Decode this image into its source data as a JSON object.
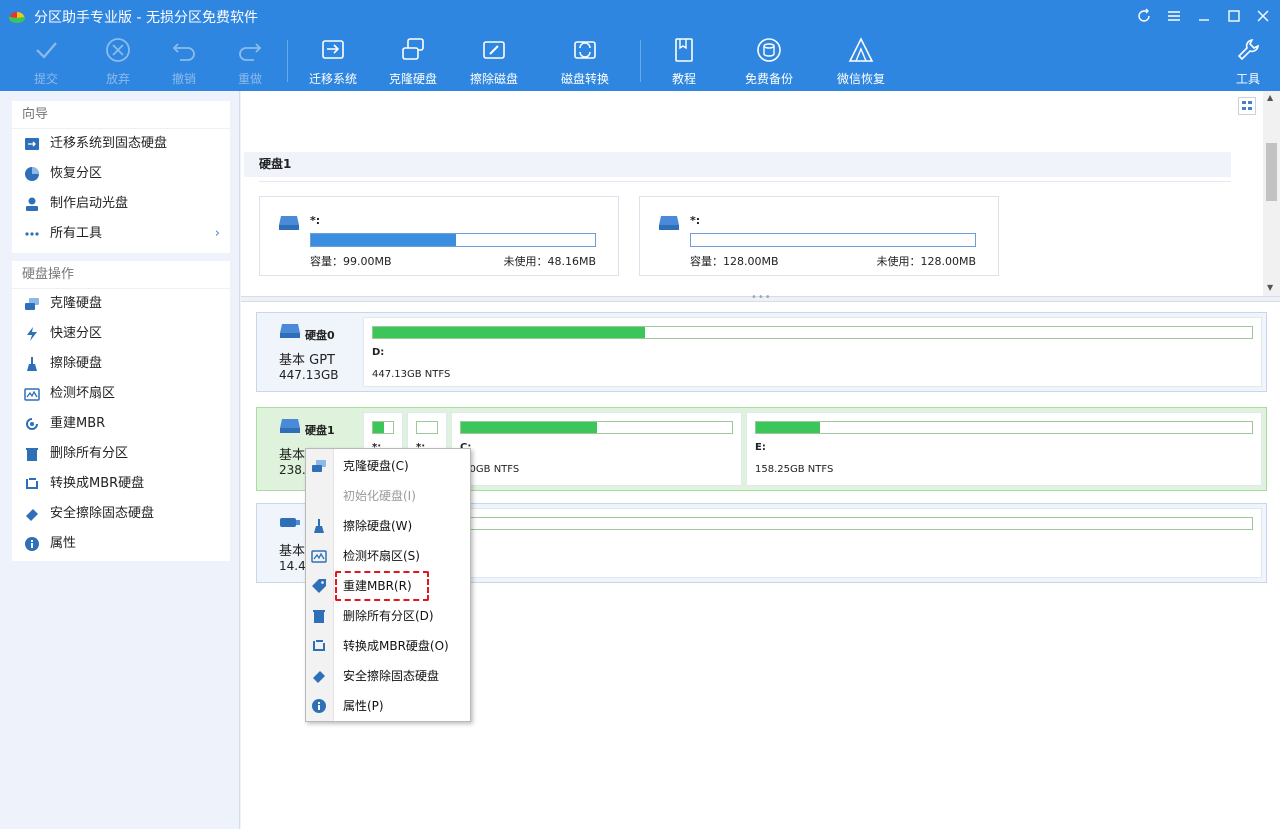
{
  "window": {
    "title": "分区助手专业版 - 无损分区免费软件",
    "controls": [
      "refresh-icon",
      "menu-icon",
      "minimize-icon",
      "maximize-icon",
      "close-icon"
    ]
  },
  "toolbar": {
    "submit": "提交",
    "discard": "放弃",
    "undo": "撤销",
    "redo": "重做",
    "migrate": "迁移系统",
    "clone": "克隆硬盘",
    "wipe": "擦除磁盘",
    "convert": "磁盘转换",
    "tutorial": "教程",
    "backup": "免费备份",
    "wechat": "微信恢复",
    "tools": "工具"
  },
  "sidebar": {
    "wizard": {
      "title": "向导",
      "items": [
        "迁移系统到固态硬盘",
        "恢复分区",
        "制作启动光盘",
        "所有工具"
      ]
    },
    "disk_ops": {
      "title": "硬盘操作",
      "items": [
        "克隆硬盘",
        "快速分区",
        "擦除硬盘",
        "检测坏扇区",
        "重建MBR",
        "删除所有分区",
        "转换成MBR硬盘",
        "安全擦除固态硬盘",
        "属性"
      ]
    }
  },
  "top_pane": {
    "disk_title": "硬盘1",
    "partitions": [
      {
        "name": "*:",
        "capacity": "容量：99.00MB",
        "unused": "未使用：48.16MB",
        "fill": 0.51
      },
      {
        "name": "*:",
        "capacity": "容量：128.00MB",
        "unused": "未使用：128.00MB",
        "fill": 0.0
      }
    ]
  },
  "disks": [
    {
      "name": "硬盘0",
      "type": "基本 GPT",
      "size": "447.13GB",
      "partitions": [
        {
          "label": "D:",
          "size": "447.13GB NTFS",
          "fill": 0.31
        }
      ]
    },
    {
      "name": "硬盘1",
      "type": "基本",
      "size": "238.4",
      "partitions": [
        {
          "label": "*:",
          "size": "",
          "fill": 0.55
        },
        {
          "label": "*:",
          "size": "",
          "fill": 0.0
        },
        {
          "label": "C:",
          "size": ".00GB NTFS",
          "fill": 0.5
        },
        {
          "label": "E:",
          "size": "158.25GB NTFS",
          "fill": 0.13
        }
      ]
    },
    {
      "name": "",
      "type": "基本",
      "size": "14.4",
      "partitions": [
        {
          "label": "",
          "size": "",
          "fill": 0.0
        }
      ]
    }
  ],
  "context_menu": {
    "items": [
      {
        "label": "克隆硬盘(C)",
        "icon": "clone-icon",
        "enabled": true
      },
      {
        "label": "初始化硬盘(I)",
        "icon": "init-icon",
        "enabled": false
      },
      {
        "label": "擦除硬盘(W)",
        "icon": "wipe-icon",
        "enabled": true
      },
      {
        "label": "检测坏扇区(S)",
        "icon": "scan-icon",
        "enabled": true
      },
      {
        "label": "重建MBR(R)",
        "icon": "tag-icon",
        "enabled": true
      },
      {
        "label": "删除所有分区(D)",
        "icon": "trash-icon",
        "enabled": true
      },
      {
        "label": "转换成MBR硬盘(O)",
        "icon": "convert-icon",
        "enabled": true
      },
      {
        "label": "安全擦除固态硬盘",
        "icon": "eraser-icon",
        "enabled": true
      },
      {
        "label": "属性(P)",
        "icon": "info-icon",
        "enabled": true
      }
    ]
  },
  "colors": {
    "accent": "#2e86e0",
    "used_green": "#3cc659",
    "used_blue": "#3b8de0",
    "highlight": "#e2161c"
  }
}
